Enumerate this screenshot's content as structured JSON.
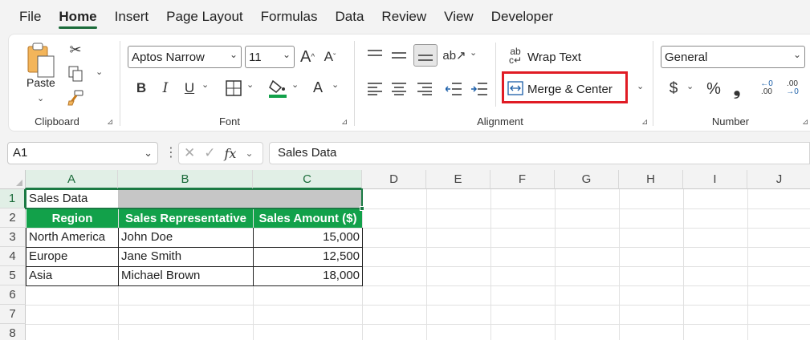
{
  "menu": {
    "tabs": [
      {
        "label": "File"
      },
      {
        "label": "Home"
      },
      {
        "label": "Insert"
      },
      {
        "label": "Page Layout"
      },
      {
        "label": "Formulas"
      },
      {
        "label": "Data"
      },
      {
        "label": "Review"
      },
      {
        "label": "View"
      },
      {
        "label": "Developer"
      }
    ],
    "active": "Home"
  },
  "ribbon": {
    "clipboard": {
      "paste_label": "Paste",
      "group_label": "Clipboard"
    },
    "font": {
      "font_name": "Aptos Narrow",
      "font_size": "11",
      "group_label": "Font",
      "bold": "B",
      "italic": "I",
      "underline": "U",
      "grow": "A",
      "shrink": "A",
      "font_color": "A"
    },
    "alignment": {
      "wrap_text_label": "Wrap Text",
      "merge_center_label": "Merge & Center",
      "group_label": "Alignment"
    },
    "number": {
      "format": "General",
      "group_label": "Number",
      "currency": "$",
      "percent": "%",
      "comma": "❟"
    }
  },
  "formula_bar": {
    "name_box": "A1",
    "fx": "fx",
    "formula": "Sales Data"
  },
  "sheet": {
    "columns": [
      "A",
      "B",
      "C",
      "D",
      "E",
      "F",
      "G",
      "H",
      "I",
      "J"
    ],
    "rows": [
      "1",
      "2",
      "3",
      "4",
      "5",
      "6",
      "7",
      "8"
    ],
    "title": "Sales Data",
    "headers": [
      "Region",
      "Sales Representative",
      "Sales Amount ($)"
    ],
    "data": [
      [
        "North America",
        "John Doe",
        "15,000"
      ],
      [
        "Europe",
        "Jane Smith",
        "12,500"
      ],
      [
        "Asia",
        "Michael Brown",
        "18,000"
      ]
    ]
  },
  "colors": {
    "accent": "#1b7a44",
    "header_fill": "#12a14a",
    "highlight": "#e01b24"
  }
}
